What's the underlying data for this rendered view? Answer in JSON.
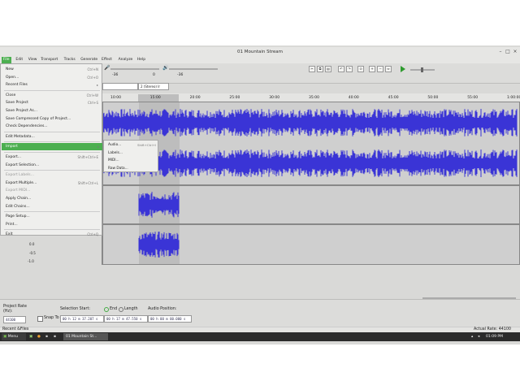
{
  "window": {
    "title": "01 Mountain Stream"
  },
  "menubar": [
    "File",
    "Edit",
    "View",
    "Transport",
    "Tracks",
    "Generate",
    "Effect",
    "Analyze",
    "Help"
  ],
  "toolbar": {
    "meter_left": "-36",
    "meter_left_zero": "0",
    "meter_right": "-36",
    "meter_right_zero": "0",
    "device_channels": "2 (Stereo) Ir"
  },
  "ruler": [
    "10:00",
    "15:00",
    "20:00",
    "25:00",
    "30:00",
    "35:00",
    "40:00",
    "45:00",
    "50:00",
    "55:00",
    "1:00:00"
  ],
  "track_scale": {
    "top": "0.0",
    "mid": "-0.5",
    "bottom": "-1.0"
  },
  "file_menu": [
    {
      "label": "New",
      "shortcut": "Ctrl+N"
    },
    {
      "label": "Open...",
      "shortcut": "Ctrl+O"
    },
    {
      "label": "Recent Files",
      "shortcut": "▸"
    },
    {
      "sep": true
    },
    {
      "label": "Close",
      "shortcut": "Ctrl+W"
    },
    {
      "label": "Save Project",
      "shortcut": "Ctrl+S"
    },
    {
      "label": "Save Project As...",
      "shortcut": ""
    },
    {
      "label": "Save Compressed Copy of Project...",
      "shortcut": ""
    },
    {
      "label": "Check Dependencies...",
      "shortcut": ""
    },
    {
      "sep": true
    },
    {
      "label": "Edit Metadata...",
      "shortcut": ""
    },
    {
      "sep": true
    },
    {
      "label": "Import",
      "shortcut": "▸",
      "highlight": true
    },
    {
      "sep": true
    },
    {
      "label": "Export...",
      "shortcut": "Shift+Ctrl+E"
    },
    {
      "label": "Export Selection...",
      "shortcut": ""
    },
    {
      "sep": true
    },
    {
      "label": "Export Labels...",
      "shortcut": "",
      "disabled": true
    },
    {
      "label": "Export Multiple...",
      "shortcut": "Shift+Ctrl+L"
    },
    {
      "label": "Export MIDI...",
      "shortcut": "",
      "disabled": true
    },
    {
      "label": "Apply Chain...",
      "shortcut": ""
    },
    {
      "label": "Edit Chains...",
      "shortcut": ""
    },
    {
      "sep": true
    },
    {
      "label": "Page Setup...",
      "shortcut": ""
    },
    {
      "label": "Print...",
      "shortcut": ""
    },
    {
      "sep": true
    },
    {
      "label": "Exit",
      "shortcut": "Ctrl+Q"
    }
  ],
  "import_submenu": [
    {
      "label": "Audio...",
      "shortcut": "Shift+Ctrl+I"
    },
    {
      "label": "Labels...",
      "shortcut": ""
    },
    {
      "label": "MIDI...",
      "shortcut": ""
    },
    {
      "label": "Raw Data...",
      "shortcut": ""
    }
  ],
  "selection_bar": {
    "project_rate_label": "Project Rate (Hz):",
    "project_rate": "44100",
    "snap_to": "Snap To",
    "selection_start_label": "Selection Start:",
    "end_label": "End",
    "length_label": "Length",
    "audio_position_label": "Audio Position:",
    "selection_start": "00 h 12 m 37.207 s",
    "selection_end": "00 h 17 m 47.550 s",
    "audio_position": "00 h 00 m 00.000 s"
  },
  "status": {
    "left": "Recent &Files",
    "right": "Actual Rate: 44100"
  },
  "taskbar": {
    "menu": "Menu",
    "app": "01 Mountain St...",
    "clock": "01:09 PM"
  },
  "colors": {
    "wave": "#3a34d6",
    "accent": "#4caf50",
    "selection": "#bdbdbd"
  }
}
